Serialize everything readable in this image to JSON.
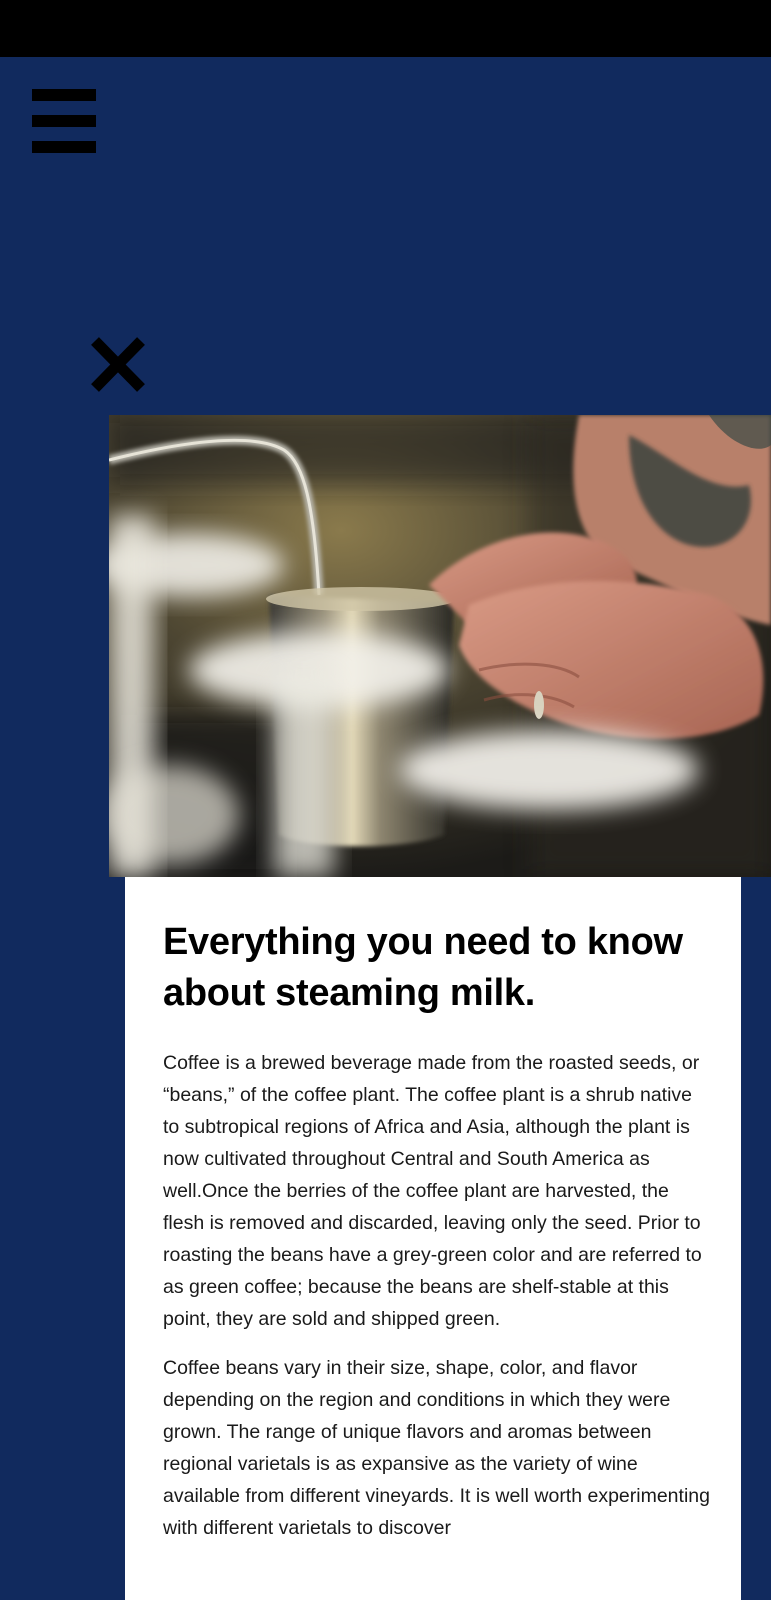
{
  "menu": {
    "icon": "hamburger-menu-icon"
  },
  "close": {
    "icon": "close-icon"
  },
  "hero": {
    "alt": "Barista steaming milk in a metal pitcher"
  },
  "article": {
    "title": "Everything you need to know about steaming milk.",
    "paragraphs": [
      "Coffee is a brewed beverage made from the roasted seeds, or “beans,” of the coffee plant. The coffee plant is a shrub native to subtropical regions of Africa and Asia, although the plant is now cultivated throughout Central and South America as well.Once the berries of the coffee plant are harvested, the flesh is removed and discarded, leaving only the seed. Prior to roasting the beans have a grey-green color and are referred to as green coffee; because the beans are shelf-stable at this point, they are sold and shipped green.",
      "Coffee beans vary in their size, shape, color, and flavor depending on the region and conditions in which they were grown. The range of unique flavors and aromas between regional varietals is as expansive as the variety of wine available from different vineyards. It is well worth experimenting with different varietals to discover"
    ]
  },
  "colors": {
    "background": "#112a5e",
    "status_bar": "#000000",
    "card": "#ffffff",
    "text": "#000000"
  }
}
